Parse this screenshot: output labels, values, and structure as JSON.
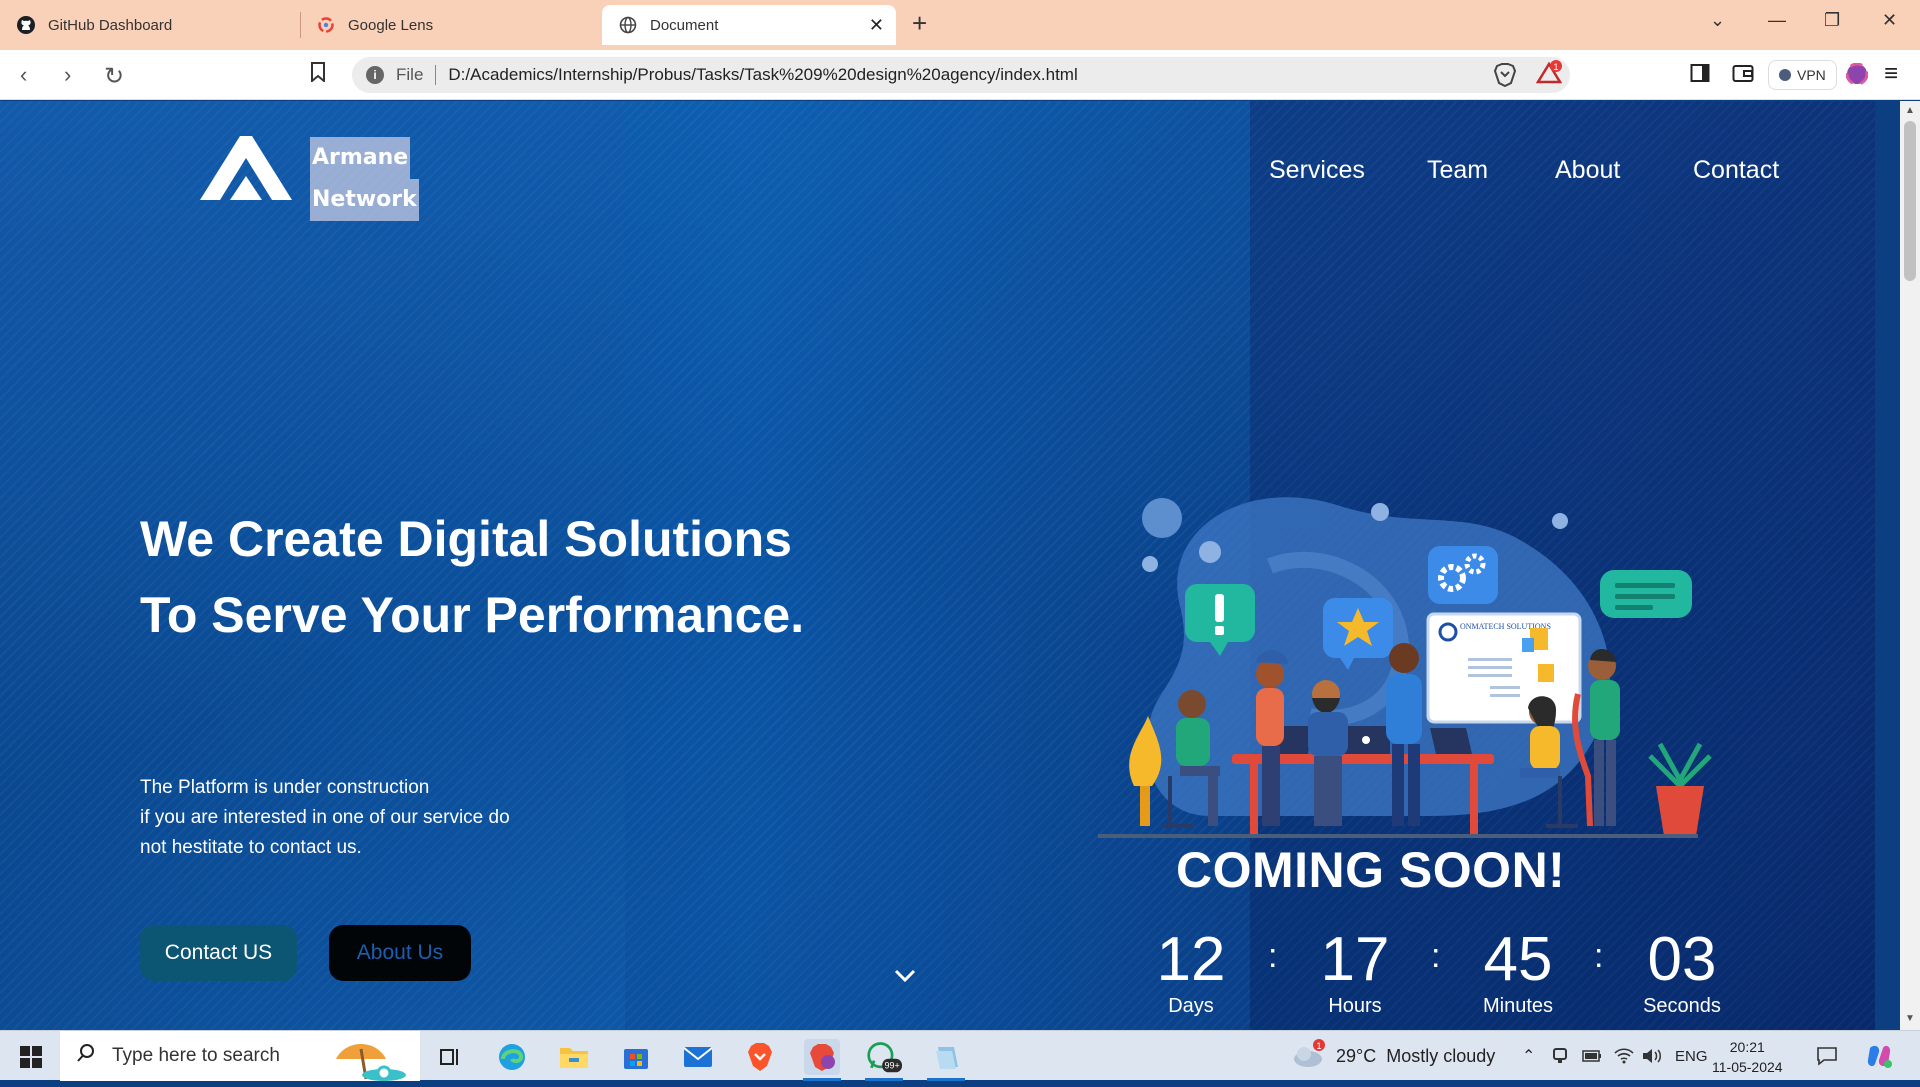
{
  "browser": {
    "tabs": [
      {
        "label": "GitHub Dashboard",
        "icon": "github-icon"
      },
      {
        "label": "Google Lens",
        "icon": "google-lens-icon"
      },
      {
        "label": "Document",
        "icon": "globe-icon",
        "active": true
      }
    ],
    "address": {
      "scheme_label": "File",
      "url": "D:/Academics/Internship/Probus/Tasks/Task%209%20design%20agency/index.html"
    },
    "notification_badge": "1",
    "vpn_label": "VPN"
  },
  "site": {
    "brand_line1": "Armane",
    "brand_line2": "Network",
    "nav": [
      "Services",
      "Team",
      "About",
      "Contact"
    ],
    "hero_line1": "We Create Digital Solutions",
    "hero_line2": "To Serve Your Performance.",
    "body_line1": "The Platform is under construction",
    "body_line2": "if you are interested in one of our service do",
    "body_line3": "not hestitate to contact us.",
    "contact_button": "Contact US",
    "about_button": "About Us",
    "illustration_sign": "ONMATECH SOLUTIONS",
    "coming_soon": "COMING SOON!",
    "countdown": [
      {
        "value": "12",
        "label": "Days"
      },
      {
        "value": "17",
        "label": "Hours"
      },
      {
        "value": "45",
        "label": "Minutes"
      },
      {
        "value": "03",
        "label": "Seconds"
      }
    ],
    "colon": ":"
  },
  "taskbar": {
    "search_placeholder": "Type here to search",
    "whatsapp_badge": "99+",
    "weather_temp": "29°C",
    "weather_desc": "Mostly cloudy",
    "weather_alert": "1",
    "language": "ENG",
    "time": "20:21",
    "date": "11-05-2024"
  },
  "colors": {
    "page_blue": "#0b58a8",
    "tab_bar": "#f9d0b8",
    "contact_button": "#0c5573",
    "about_button": "#020508"
  }
}
